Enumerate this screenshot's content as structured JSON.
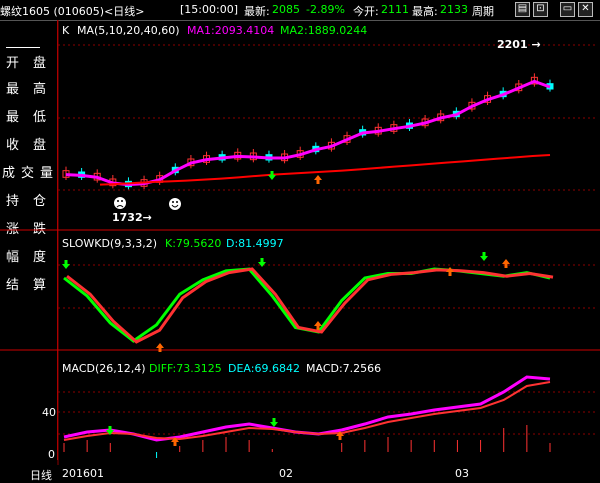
{
  "header": {
    "title": "螺纹1605 (010605)<日线>",
    "time": "[15:00:00]",
    "latest_label": "最新:",
    "latest_value": "2085",
    "change_pct": "-2.89%",
    "open_label": "今开:",
    "open_value": "2111",
    "high_label": "最高:",
    "high_value": "2133",
    "period_label": "周期"
  },
  "sidebar": {
    "items": [
      {
        "label": "开盘"
      },
      {
        "label": "最高"
      },
      {
        "label": "最低"
      },
      {
        "label": "收盘"
      },
      {
        "label": "成交量"
      },
      {
        "label": "持仓"
      },
      {
        "label": "涨跌"
      },
      {
        "label": "幅度"
      },
      {
        "label": "结算"
      }
    ]
  },
  "main_chart": {
    "label_k": "K",
    "ma_label": "MA(5,10,20,40,60)",
    "ma1": "MA1:2093.4104",
    "ma2": "MA2:1889.0244",
    "high_marker": "2201",
    "low_marker": "1732"
  },
  "kd_chart": {
    "label": "SLOWKD(9,3,3,2)",
    "k_value": "K:79.5620",
    "d_value": "D:81.4997"
  },
  "macd_chart": {
    "label": "MACD(26,12,4)",
    "diff": "DIFF:73.3125",
    "dea": "DEA:69.6842",
    "macd": "MACD:7.2566",
    "y_ticks": [
      "40",
      "0"
    ]
  },
  "x_axis": {
    "period": "日线",
    "labels": [
      "201601",
      "02",
      "03"
    ]
  },
  "colors": {
    "up": "#ff3232",
    "down": "#00ffff",
    "ma1": "#ff00ff",
    "ma2": "#ff0000",
    "green": "#00ff00",
    "yellow": "#ffff00",
    "grid": "#8b0000"
  },
  "chart_data": {
    "type": "candlestick",
    "x": [
      "201601",
      "02",
      "03"
    ],
    "price_series": [
      {
        "name": "MA1",
        "values": [
          1830,
          1828,
          1822,
          1805,
          1800,
          1803,
          1815,
          1842,
          1865,
          1875,
          1880,
          1885,
          1883,
          1880,
          1880,
          1890,
          1905,
          1915,
          1935,
          1955,
          1960,
          1968,
          1975,
          1985,
          2000,
          2010,
          2035,
          2055,
          2070,
          2090,
          2110,
          2093
        ]
      },
      {
        "name": "MA2",
        "values": [
          1800,
          1802,
          1805,
          1808,
          1810,
          1812,
          1815,
          1818,
          1822,
          1826,
          1830,
          1833,
          1836,
          1839,
          1842,
          1846,
          1850,
          1854,
          1858,
          1862,
          1866,
          1870,
          1874,
          1878,
          1882,
          1886,
          1889
        ]
      }
    ],
    "annotations": [
      {
        "label": "2201",
        "kind": "period-high"
      },
      {
        "label": "1732",
        "kind": "period-low"
      }
    ],
    "kd": {
      "K": [
        80,
        60,
        30,
        10,
        28,
        62,
        78,
        88,
        90,
        60,
        25,
        20,
        55,
        80,
        85,
        85,
        90,
        88,
        85,
        82,
        86,
        80
      ],
      "D": [
        82,
        62,
        32,
        9,
        22,
        58,
        76,
        86,
        90,
        62,
        25,
        20,
        52,
        78,
        84,
        86,
        89,
        88,
        86,
        82,
        85,
        81
      ],
      "ylim": [
        0,
        100
      ]
    },
    "macd": {
      "DIFF": [
        15,
        20,
        22,
        18,
        12,
        15,
        20,
        25,
        28,
        24,
        20,
        18,
        22,
        28,
        35,
        38,
        42,
        45,
        48,
        60,
        75,
        73
      ],
      "DEA": [
        12,
        16,
        19,
        18,
        14,
        13,
        16,
        20,
        24,
        23,
        20,
        18,
        19,
        24,
        30,
        34,
        38,
        41,
        44,
        52,
        66,
        70
      ],
      "yticks": [
        0,
        40
      ]
    }
  }
}
